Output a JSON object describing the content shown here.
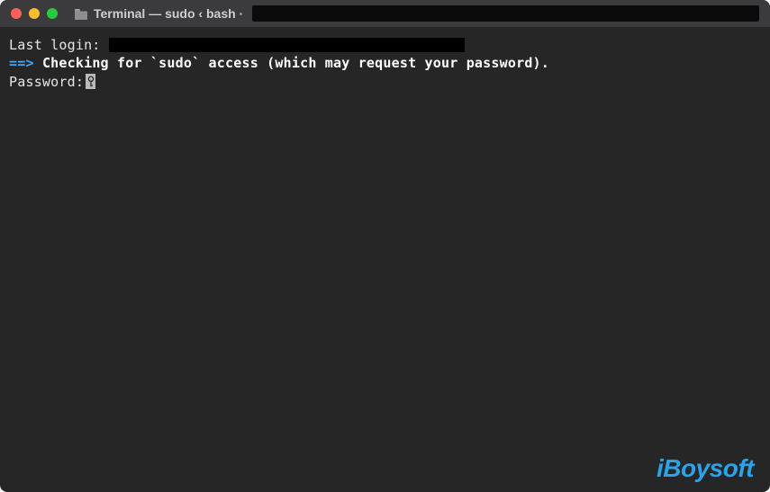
{
  "titlebar": {
    "title": "Terminal — sudo ‹ bash ·"
  },
  "terminal": {
    "last_login_label": "Last login:",
    "arrow": "==>",
    "checking_msg": "Checking for `sudo` access (which may request your password).",
    "password_label": "Password:"
  },
  "watermark": {
    "text": "iBoysoft"
  },
  "colors": {
    "arrow": "#3fa9f5",
    "background": "#262626",
    "titlebar": "#3b3a3c",
    "watermark": "#2aa3e8"
  }
}
